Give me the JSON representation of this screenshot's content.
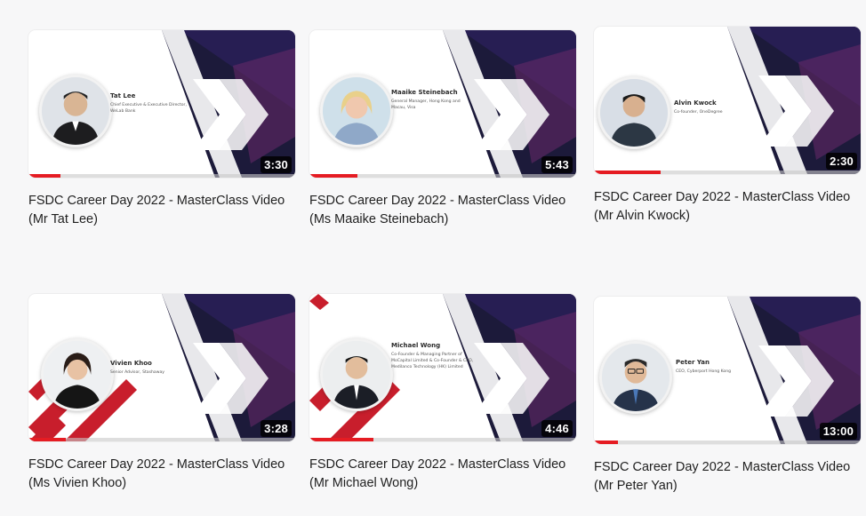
{
  "colors": {
    "accent_red": "#e51c23",
    "dark_panel": "#1c1a3a",
    "chevron": "#ffffff"
  },
  "videos": [
    {
      "speaker": "Tat Lee",
      "role": "Chief Executive & Executive Director, WeLab Bank",
      "duration": "3:30",
      "title": "FSDC Career Day 2022 - MasterClass Video (Mr Tat Lee)",
      "progress": 0.12
    },
    {
      "speaker": "Maaike Steinebach",
      "role": "General Manager, Hong Kong and Macau, Visa",
      "duration": "5:43",
      "title": "FSDC Career Day 2022 - MasterClass Video (Ms Maaike Steinebach)",
      "progress": 0.18
    },
    {
      "speaker": "Alvin Kwock",
      "role": "Co-founder, OneDegree",
      "duration": "2:30",
      "title": "FSDC Career Day 2022 - MasterClass Video (Mr Alvin Kwock)",
      "progress": 0.25
    },
    {
      "speaker": "Vivien Khoo",
      "role": "Senior Advisor, Stashaway",
      "duration": "3:28",
      "title": "FSDC Career Day 2022 - MasterClass Video (Ms Vivien Khoo)",
      "progress": 0.14
    },
    {
      "speaker": "Michael Wong",
      "role": "Co-Founder & Managing Partner of MoCapital Limited & Co-Founder & CEO, Medilanco Technology (HK) Limited",
      "duration": "4:46",
      "title": "FSDC Career Day 2022 - MasterClass Video (Mr Michael Wong)",
      "progress": 0.24
    },
    {
      "speaker": "Peter Yan",
      "role": "CEO, Cyberport Hong Kong",
      "duration": "13:00",
      "title": "FSDC Career Day 2022 - MasterClass Video (Mr Peter Yan)",
      "progress": 0.09
    }
  ]
}
